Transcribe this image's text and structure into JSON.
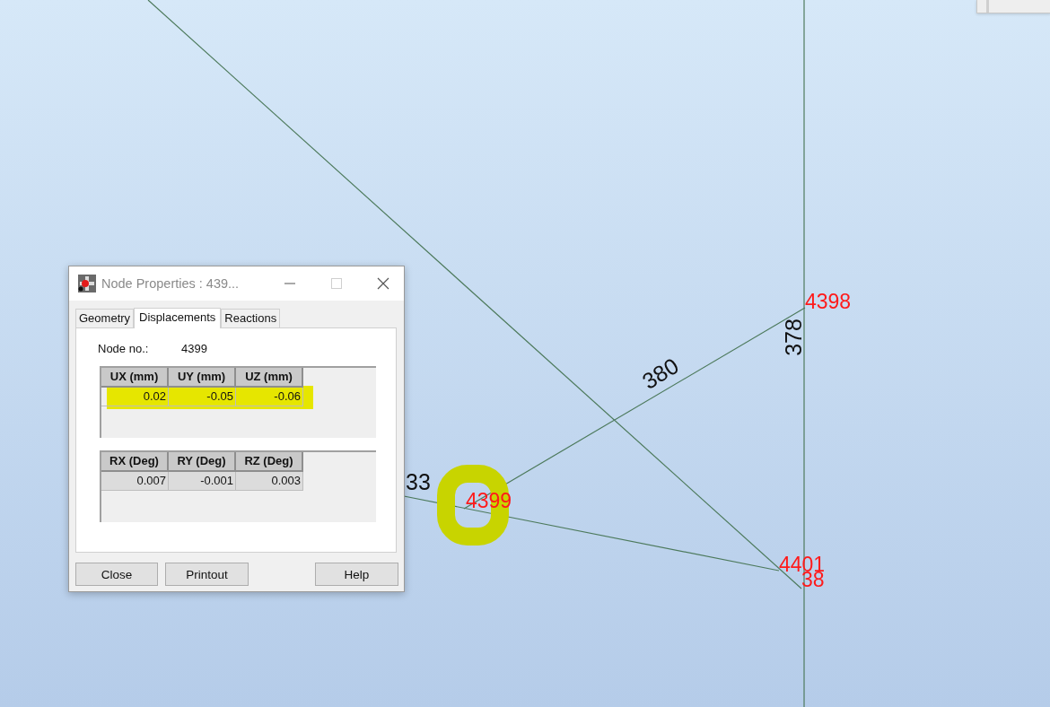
{
  "canvas": {
    "member_labels": [
      {
        "text": "380"
      },
      {
        "text": "378"
      },
      {
        "text": "33"
      }
    ],
    "node_labels": [
      {
        "text": "4398"
      },
      {
        "text": "4399"
      },
      {
        "text": "4401"
      },
      {
        "text": "38"
      }
    ]
  },
  "dialog": {
    "title": "Node Properties : 439...",
    "tabs": [
      {
        "label": "Geometry",
        "selected": false
      },
      {
        "label": "Displacements",
        "selected": true
      },
      {
        "label": "Reactions",
        "selected": false
      }
    ],
    "node_label": "Node no.:",
    "node_value": "4399",
    "tables": [
      {
        "columns": [
          "UX (mm)",
          "UY (mm)",
          "UZ (mm)"
        ],
        "row": [
          "0.02",
          "-0.05",
          "-0.06"
        ]
      },
      {
        "columns": [
          "RX (Deg)",
          "RY (Deg)",
          "RZ (Deg)"
        ],
        "row": [
          "0.007",
          "-0.001",
          "0.003"
        ]
      }
    ],
    "buttons": [
      "Close",
      "Printout",
      "Help"
    ]
  }
}
